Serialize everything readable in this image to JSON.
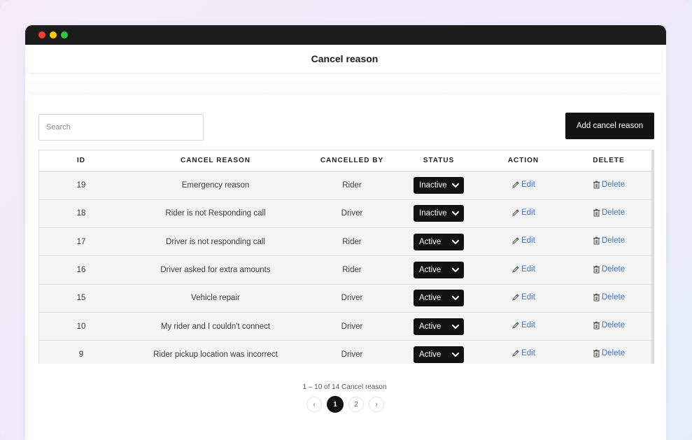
{
  "window": {
    "controls": [
      "close",
      "minimize",
      "maximize"
    ]
  },
  "page": {
    "title": "Cancel reason"
  },
  "toolbar": {
    "search_placeholder": "Search",
    "add_label": "Add cancel reason"
  },
  "table": {
    "headers": {
      "id": "ID",
      "reason": "CANCEL REASON",
      "by": "CANCELLED BY",
      "status": "STATUS",
      "action": "ACTION",
      "delete": "DELETE"
    },
    "rows": [
      {
        "id": "19",
        "reason": "Emergency reason",
        "by": "Rider",
        "status": "Inactive",
        "edit": "Edit",
        "delete": "Delete"
      },
      {
        "id": "18",
        "reason": "Rider is not Responding call",
        "by": "Driver",
        "status": "Inactive",
        "edit": "Edit",
        "delete": "Delete"
      },
      {
        "id": "17",
        "reason": "Driver is not responding call",
        "by": "Rider",
        "status": "Active",
        "edit": "Edit",
        "delete": "Delete"
      },
      {
        "id": "16",
        "reason": "Driver asked for extra amounts",
        "by": "Rider",
        "status": "Active",
        "edit": "Edit",
        "delete": "Delete"
      },
      {
        "id": "15",
        "reason": "Vehicle repair",
        "by": "Driver",
        "status": "Active",
        "edit": "Edit",
        "delete": "Delete"
      },
      {
        "id": "10",
        "reason": "My rider and I couldn't connect",
        "by": "Driver",
        "status": "Active",
        "edit": "Edit",
        "delete": "Delete"
      },
      {
        "id": "9",
        "reason": "Rider pickup location was incorrect",
        "by": "Driver",
        "status": "Active",
        "edit": "Edit",
        "delete": "Delete"
      }
    ]
  },
  "pagination": {
    "info": "1 – 10 of 14 Cancel reason",
    "prev": "‹",
    "pages": [
      "1",
      "2"
    ],
    "current": "1",
    "next": "›"
  },
  "colors": {
    "accent_link": "#3e6fd8",
    "button_dark": "#111111",
    "titlebar": "#1c1c1c"
  },
  "icons": {
    "edit": "pencil-icon",
    "delete": "trash-icon",
    "status": "chevron-down-icon"
  }
}
